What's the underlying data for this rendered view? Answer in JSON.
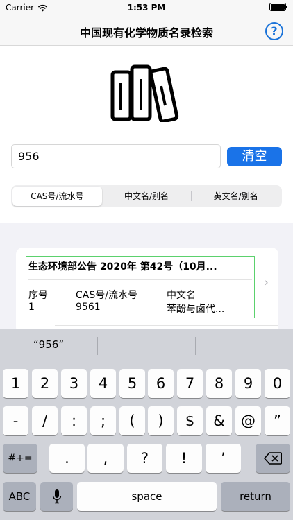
{
  "status_bar": {
    "carrier": "Carrier",
    "time": "1:53 PM"
  },
  "nav": {
    "title": "中国现有化学物质名录检索",
    "help_label": "?"
  },
  "search": {
    "value": "956",
    "clear_label": "清空"
  },
  "segments": [
    {
      "label": "CAS号/流水号",
      "active": true
    },
    {
      "label": "中文名/别名",
      "active": false
    },
    {
      "label": "英文名/别名",
      "active": false
    }
  ],
  "result": {
    "title": "生态环境部公告 2020年 第42号（10月...",
    "headers": [
      "序号",
      "CAS号/流水号",
      "中文名"
    ],
    "values": [
      "1",
      "9561",
      "苯酚与卤代..."
    ]
  },
  "keyboard": {
    "suggestion": "“956”",
    "row1": [
      "1",
      "2",
      "3",
      "4",
      "5",
      "6",
      "7",
      "8",
      "9",
      "0"
    ],
    "row2": [
      "-",
      "/",
      ":",
      ";",
      "(",
      ")",
      "$",
      "&",
      "@",
      "”"
    ],
    "row3_left": "#+=",
    "row3": [
      ".",
      ",",
      "?",
      "!",
      "’"
    ],
    "abc": "ABC",
    "space": "space",
    "return": "return"
  },
  "colors": {
    "accent": "#1a73e8",
    "result_border": "#5bd16d"
  }
}
